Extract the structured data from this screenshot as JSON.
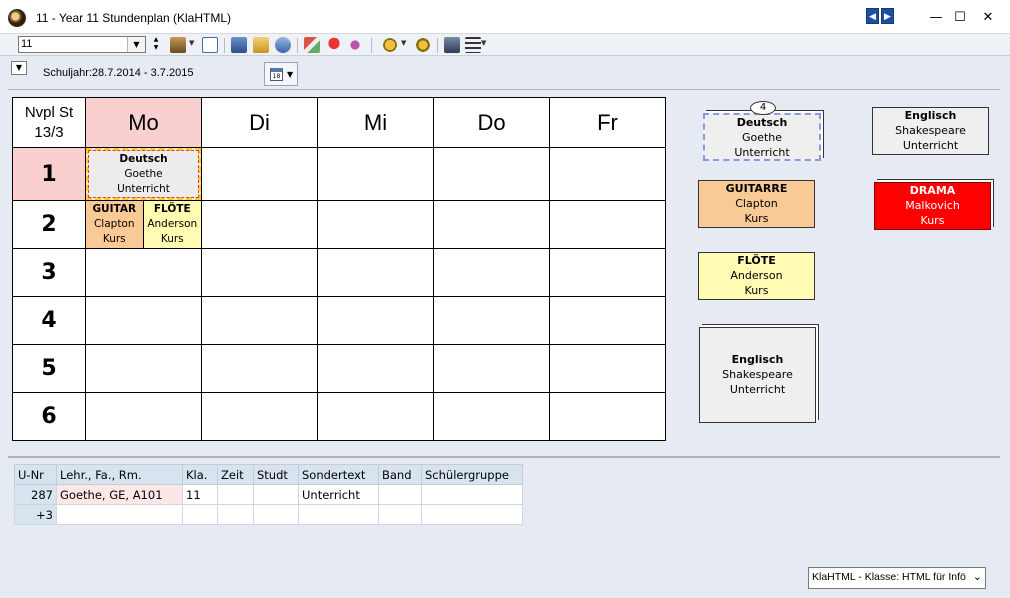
{
  "window": {
    "title": "11 - Year 11  Stundenplan  (KlaHTML)",
    "minimize": "—",
    "maximize": "☐",
    "close": "✕",
    "prev": "◀",
    "next": "▶"
  },
  "toolbar": {
    "class_select_value": "11",
    "icons": [
      "teachers-icon",
      "grid-icon",
      "export-icon",
      "lock-icon",
      "undo-icon",
      "brush-icon",
      "pin-icon",
      "link-icon",
      "settings-icon",
      "gear-icon",
      "people-icon",
      "list-icon"
    ]
  },
  "header": {
    "schuljahr": "Schuljahr:28.7.2014 - 3.7.2015",
    "calendar_day": "18"
  },
  "timetable": {
    "corner_line1": "Nvpl St",
    "corner_line2": "13/3",
    "days": [
      "Mo",
      "Di",
      "Mi",
      "Do",
      "Fr"
    ],
    "hours": [
      "1",
      "2",
      "3",
      "4",
      "5",
      "6"
    ],
    "lessons": {
      "deutsch": {
        "subject": "Deutsch",
        "teacher": "Goethe",
        "type": "Unterricht"
      },
      "guitar": {
        "subject": "GUITAR",
        "teacher": "Clapton",
        "type": "Kurs"
      },
      "flote": {
        "subject": "FLÖTE",
        "teacher": "Anderson",
        "type": "Kurs"
      }
    }
  },
  "cards": {
    "deutsch": {
      "subject": "Deutsch",
      "teacher": "Goethe",
      "type": "Unterricht",
      "badge": "4"
    },
    "guitarre": {
      "subject": "GUITARRE",
      "teacher": "Clapton",
      "type": "Kurs"
    },
    "flote": {
      "subject": "FLÖTE",
      "teacher": "Anderson",
      "type": "Kurs"
    },
    "englisch_big": {
      "subject": "Englisch",
      "teacher": "Shakespeare",
      "type": "Unterricht"
    },
    "englisch": {
      "subject": "Englisch",
      "teacher": "Shakespeare",
      "type": "Unterricht"
    },
    "drama": {
      "subject": "DRAMA",
      "teacher": "Malkovich",
      "type": "Kurs"
    }
  },
  "grid": {
    "headers": [
      "U-Nr",
      "Lehr., Fa., Rm.",
      "Kla.",
      "Zeit",
      "Studt",
      "Sondertext",
      "Band",
      "Schülergruppe"
    ],
    "row1": {
      "unr": "287",
      "lfr": "Goethe, GE, A101",
      "kla": "11",
      "zeit": "",
      "studt": "",
      "sondertext": "Unterricht",
      "band": "",
      "gruppe": ""
    },
    "row2": {
      "unr": "+3"
    }
  },
  "status": {
    "view_select": "KlaHTML - Klasse: HTML für Infö"
  }
}
